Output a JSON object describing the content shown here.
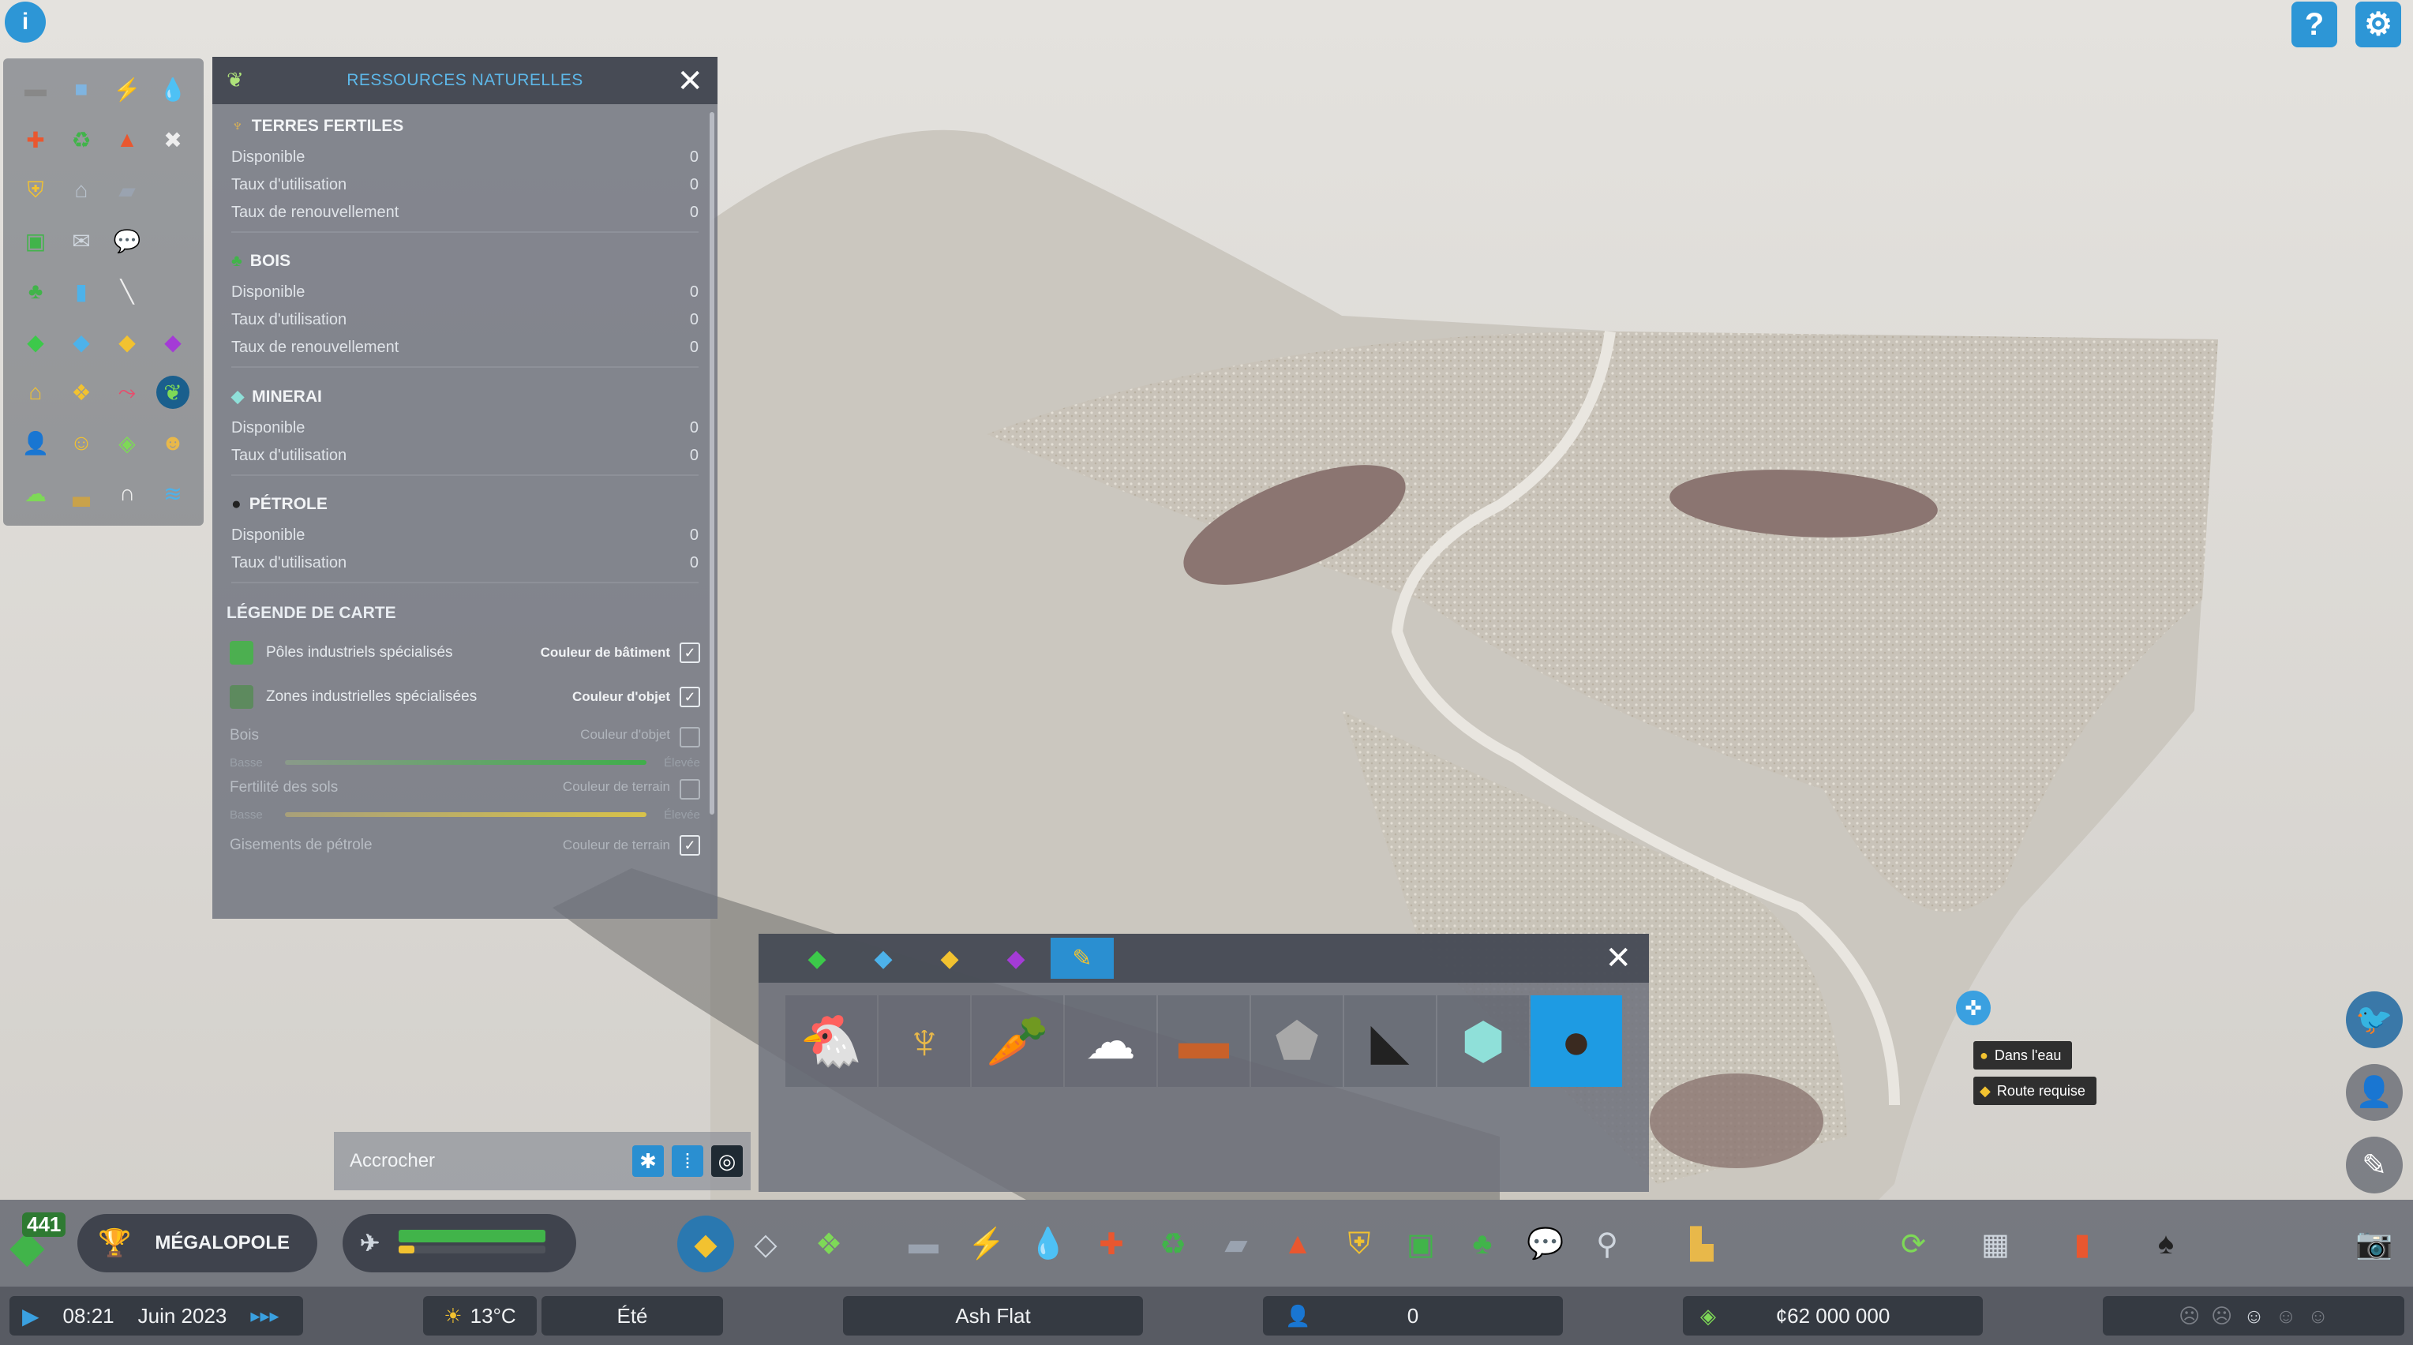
{
  "resources_panel": {
    "title": "RESSOURCES NATURELLES",
    "sections": [
      {
        "title": "TERRES FERTILES",
        "rows": [
          {
            "label": "Disponible",
            "value": "0"
          },
          {
            "label": "Taux d'utilisation",
            "value": "0"
          },
          {
            "label": "Taux de renouvellement",
            "value": "0"
          }
        ]
      },
      {
        "title": "BOIS",
        "rows": [
          {
            "label": "Disponible",
            "value": "0"
          },
          {
            "label": "Taux d'utilisation",
            "value": "0"
          },
          {
            "label": "Taux de renouvellement",
            "value": "0"
          }
        ]
      },
      {
        "title": "MINERAI",
        "rows": [
          {
            "label": "Disponible",
            "value": "0"
          },
          {
            "label": "Taux d'utilisation",
            "value": "0"
          }
        ]
      },
      {
        "title": "PÉTROLE",
        "rows": [
          {
            "label": "Disponible",
            "value": "0"
          },
          {
            "label": "Taux d'utilisation",
            "value": "0"
          }
        ]
      }
    ],
    "legend_title": "LÉGENDE DE CARTE",
    "legend": [
      {
        "label": "Pôles industriels spécialisés",
        "tag": "Couleur de bâtiment",
        "checked": true,
        "color": "#4caf50"
      },
      {
        "label": "Zones industrielles spécialisées",
        "tag": "Couleur d'objet",
        "checked": true,
        "color": "#5d8a5e"
      },
      {
        "label": "Bois",
        "tag": "Couleur d'objet",
        "checked": false,
        "low": "Basse",
        "high": "Élevée"
      },
      {
        "label": "Fertilité des sols",
        "tag": "Couleur de terrain",
        "checked": false,
        "low": "Basse",
        "high": "Élevée"
      },
      {
        "label": "Gisements de pétrole",
        "tag": "Couleur de terrain",
        "checked": true
      }
    ]
  },
  "snap": {
    "label": "Accrocher"
  },
  "tooltips": {
    "water": "Dans l'eau",
    "road": "Route requise"
  },
  "bottom": {
    "population_badge": "441",
    "milestone": "MÉGALOPOLE",
    "time": "08:21",
    "date": "Juin 2023",
    "temperature": "13°C",
    "season": "Été",
    "city_name": "Ash Flat",
    "population": "0",
    "money": "¢62 000 000"
  },
  "icons": {
    "info": "info-icon",
    "help": "help-icon",
    "settings": "gear-icon",
    "close": "close-icon"
  }
}
